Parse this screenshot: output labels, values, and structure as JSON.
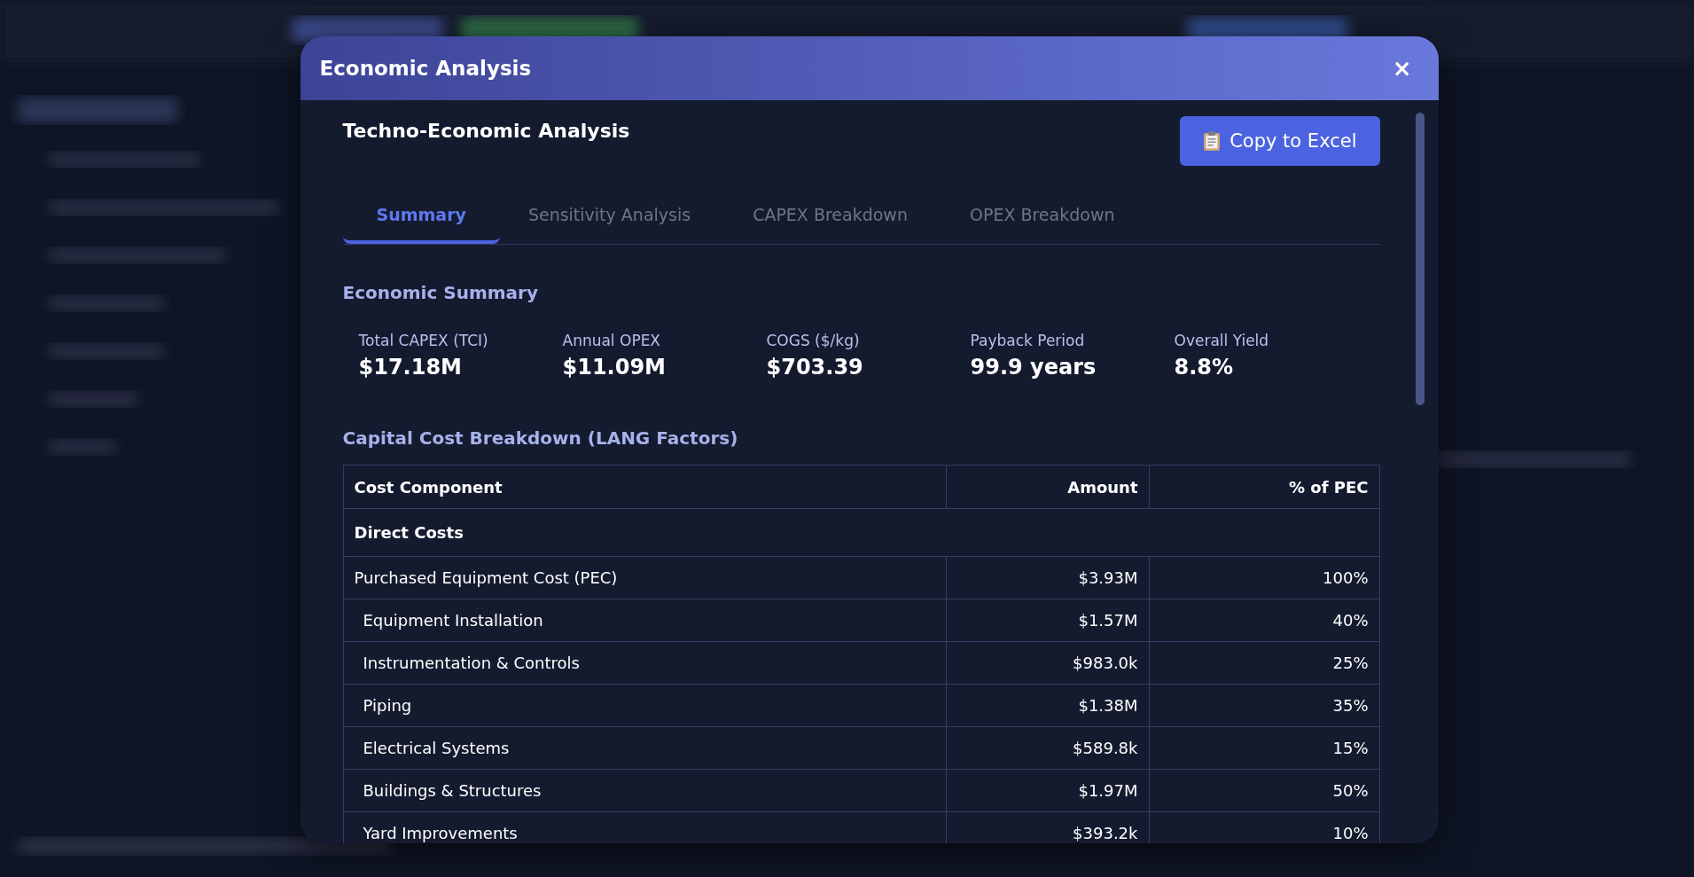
{
  "dialog": {
    "title": "Economic Analysis",
    "close": "×"
  },
  "heading": "Techno-Economic Analysis",
  "copy_button": "Copy to Excel",
  "tabs": [
    {
      "label": "Summary",
      "selected": true
    },
    {
      "label": "Sensitivity Analysis",
      "selected": false
    },
    {
      "label": "CAPEX Breakdown",
      "selected": false
    },
    {
      "label": "OPEX Breakdown",
      "selected": false
    }
  ],
  "summary": {
    "title": "Economic Summary",
    "metrics": [
      {
        "label": "Total CAPEX (TCI)",
        "value": "$17.18M"
      },
      {
        "label": "Annual OPEX",
        "value": "$11.09M"
      },
      {
        "label": "COGS ($/kg)",
        "value": "$703.39"
      },
      {
        "label": "Payback Period",
        "value": "99.9 years"
      },
      {
        "label": "Overall Yield",
        "value": "8.8%"
      }
    ]
  },
  "capital": {
    "title": "Capital Cost Breakdown (LANG Factors)",
    "table": {
      "columns": [
        "Cost Component",
        "Amount",
        "% of PEC"
      ],
      "rows": [
        {
          "kind": "section",
          "label": "Direct Costs"
        },
        {
          "kind": "item",
          "label": "Purchased Equipment Cost (PEC)",
          "amount": "$3.93M",
          "pct": "100%",
          "children": [
            {
              "kind": "item",
              "label": "Equipment Installation",
              "amount": "$1.57M",
              "pct": "40%"
            },
            {
              "kind": "item",
              "label": "Instrumentation & Controls",
              "amount": "$983.0k",
              "pct": "25%"
            },
            {
              "kind": "item",
              "label": "Piping",
              "amount": "$1.38M",
              "pct": "35%"
            },
            {
              "kind": "item",
              "label": "Electrical Systems",
              "amount": "$589.8k",
              "pct": "15%"
            },
            {
              "kind": "item",
              "label": "Buildings & Structures",
              "amount": "$1.97M",
              "pct": "50%"
            },
            {
              "kind": "item",
              "label": "Yard Improvements",
              "amount": "$393.2k",
              "pct": "10%"
            }
          ]
        }
      ]
    }
  }
}
